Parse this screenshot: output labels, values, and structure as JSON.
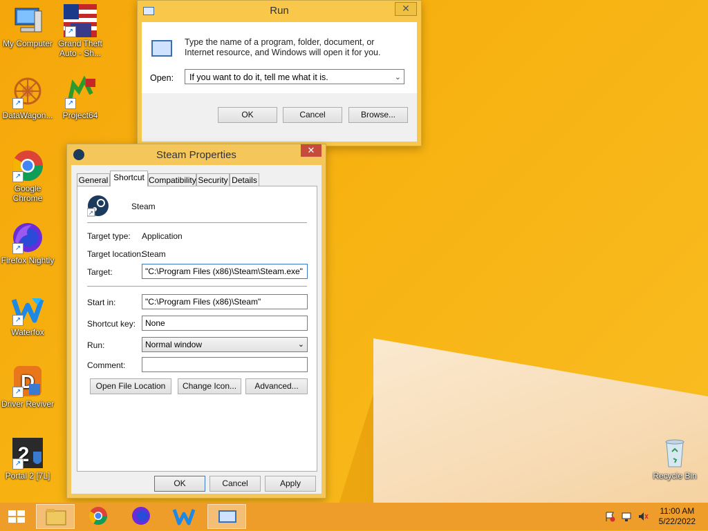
{
  "desktop": {
    "icons": [
      {
        "label": "My Computer"
      },
      {
        "label": "Grand Theft Auto - Sh..."
      },
      {
        "label": "DataWagon..."
      },
      {
        "label": "Project64"
      },
      {
        "label": "Google Chrome"
      },
      {
        "label": "Firefox Nightly"
      },
      {
        "label": "Waterfox"
      },
      {
        "label": "Driver Reviver"
      },
      {
        "label": "Portal 2 [7L]"
      },
      {
        "label": "Recycle Bin"
      }
    ]
  },
  "run_dialog": {
    "title": "Run",
    "description": "Type the name of a program, folder, document, or Internet resource, and Windows will open it for you.",
    "open_label": "Open:",
    "open_value": "If you want to do it, tell me what it is.",
    "ok": "OK",
    "cancel": "Cancel",
    "browse": "Browse..."
  },
  "steam_properties": {
    "title": "Steam Properties",
    "tabs": [
      "General",
      "Shortcut",
      "Compatibility",
      "Security",
      "Details"
    ],
    "active_tab": "Shortcut",
    "app_name": "Steam",
    "target_type_label": "Target type:",
    "target_type": "Application",
    "target_location_label": "Target location:",
    "target_location": "Steam",
    "target_label": "Target:",
    "target": "\"C:\\Program Files (x86)\\Steam\\Steam.exe\"",
    "start_in_label": "Start in:",
    "start_in": "\"C:\\Program Files (x86)\\Steam\"",
    "shortcut_key_label": "Shortcut key:",
    "shortcut_key": "None",
    "run_label": "Run:",
    "run": "Normal window",
    "comment_label": "Comment:",
    "comment": "",
    "open_file_location": "Open File Location",
    "change_icon": "Change Icon...",
    "advanced": "Advanced...",
    "ok": "OK",
    "cancel": "Cancel",
    "apply": "Apply"
  },
  "taskbar": {
    "time": "11:00 AM",
    "date": "5/22/2022"
  },
  "colors": {
    "desktop_bg": "#f7b312",
    "taskbar": "#ee9c2a",
    "window_frame": "#f5c65a",
    "close_red": "#c74b3b"
  }
}
